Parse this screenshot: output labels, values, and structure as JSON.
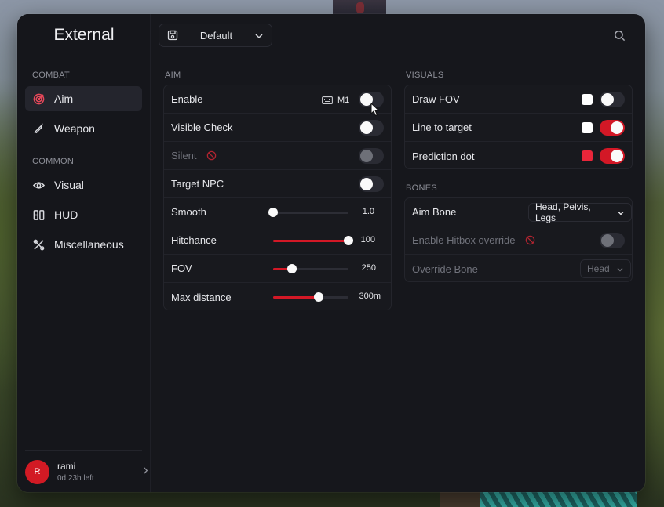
{
  "app": {
    "title": "External"
  },
  "sidebar": {
    "sections": [
      {
        "title": "COMBAT",
        "items": [
          {
            "label": "Aim",
            "icon": "target-icon",
            "active": true
          },
          {
            "label": "Weapon",
            "icon": "bullet-icon"
          }
        ]
      },
      {
        "title": "COMMON",
        "items": [
          {
            "label": "Visual",
            "icon": "eye-icon"
          },
          {
            "label": "HUD",
            "icon": "hud-icon"
          },
          {
            "label": "Miscellaneous",
            "icon": "tools-icon"
          }
        ]
      }
    ],
    "user": {
      "initial": "R",
      "name": "rami",
      "subscription": "0d 23h left"
    }
  },
  "header": {
    "config_name": "Default"
  },
  "aim": {
    "title": "AIM",
    "enable": {
      "label": "Enable",
      "keybind": "M1",
      "value": false
    },
    "visible_check": {
      "label": "Visible Check",
      "value": false
    },
    "silent": {
      "label": "Silent",
      "value": false,
      "disabled": true
    },
    "target_npc": {
      "label": "Target NPC",
      "value": false
    },
    "smooth": {
      "label": "Smooth",
      "value": 1.0,
      "display": "1.0",
      "fraction": 0.0
    },
    "hitchance": {
      "label": "Hitchance",
      "value": 100,
      "display": "100",
      "fraction": 1.0
    },
    "fov": {
      "label": "FOV",
      "value": 250,
      "display": "250",
      "fraction": 0.25
    },
    "max_distance": {
      "label": "Max distance",
      "value": 300,
      "display": "300m",
      "fraction": 0.6
    }
  },
  "visuals": {
    "title": "VISUALS",
    "draw_fov": {
      "label": "Draw FOV",
      "color": "#ffffff",
      "value": false
    },
    "line_to_target": {
      "label": "Line to target",
      "color": "#ffffff",
      "value": true
    },
    "prediction_dot": {
      "label": "Prediction dot",
      "color": "#e8263a",
      "value": true
    }
  },
  "bones": {
    "title": "BONES",
    "aim_bone": {
      "label": "Aim Bone",
      "value": "Head, Pelvis, Legs"
    },
    "hitbox_override": {
      "label": "Enable Hitbox override",
      "value": false,
      "disabled": true
    },
    "override_bone": {
      "label": "Override Bone",
      "value": "Head",
      "disabled": true
    }
  },
  "colors": {
    "accent": "#d31826",
    "panel": "#18191e",
    "window": "#16171c"
  }
}
